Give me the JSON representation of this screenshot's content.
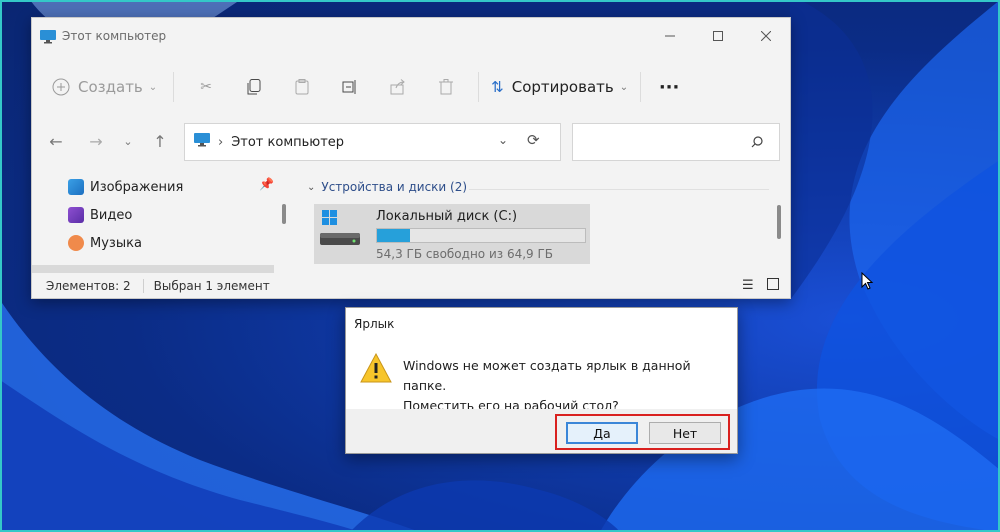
{
  "colors": {
    "accent": "#26a0da",
    "highlight": "#d9211f",
    "frame": "#34c8c8"
  },
  "explorer": {
    "title": "Этот компьютер",
    "toolbar": {
      "create_label": "Создать",
      "sort_label": "Сортировать",
      "icons": [
        "cut-icon",
        "copy-icon",
        "paste-icon",
        "rename-icon",
        "share-icon",
        "delete-icon",
        "more-icon"
      ]
    },
    "address": {
      "path": "Этот компьютер"
    },
    "nav_items": [
      {
        "label": "Изображения",
        "icon": "pictures-icon"
      },
      {
        "label": "Видео",
        "icon": "video-icon"
      },
      {
        "label": "Музыка",
        "icon": "music-icon"
      }
    ],
    "group_header": "Устройства и диски (2)",
    "drive": {
      "name": "Локальный диск (C:)",
      "free_text": "54,3 ГБ свободно из 64,9 ГБ",
      "used_fraction": 0.16
    },
    "status": {
      "count": "Элементов: 2",
      "selected": "Выбран 1 элемент"
    }
  },
  "dialog": {
    "title": "Ярлык",
    "message_line1": "Windows не может создать ярлык в данной папке.",
    "message_line2": "Поместить его на рабочий стол?",
    "yes_label": "Да",
    "no_label": "Нет"
  }
}
